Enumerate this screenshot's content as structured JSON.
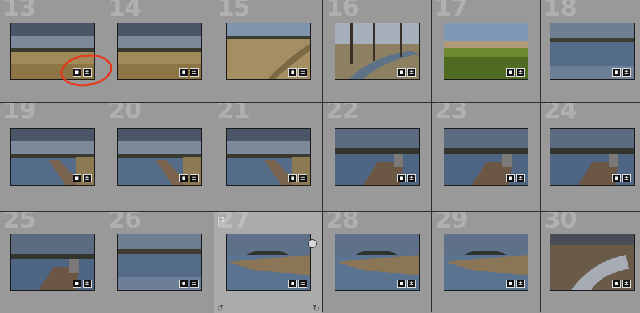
{
  "grid": {
    "cells": [
      {
        "num": "13",
        "scene": "field",
        "selected": false
      },
      {
        "num": "14",
        "scene": "field",
        "selected": false
      },
      {
        "num": "15",
        "scene": "meadow",
        "selected": false
      },
      {
        "num": "16",
        "scene": "creek",
        "selected": false
      },
      {
        "num": "17",
        "scene": "lawn",
        "selected": false
      },
      {
        "num": "18",
        "scene": "lake",
        "selected": false
      },
      {
        "num": "19",
        "scene": "dock",
        "selected": false
      },
      {
        "num": "20",
        "scene": "dock",
        "selected": false
      },
      {
        "num": "21",
        "scene": "dock",
        "selected": false
      },
      {
        "num": "22",
        "scene": "pier",
        "selected": false
      },
      {
        "num": "23",
        "scene": "pier",
        "selected": false
      },
      {
        "num": "24",
        "scene": "pier",
        "selected": false
      },
      {
        "num": "25",
        "scene": "pier",
        "selected": false
      },
      {
        "num": "26",
        "scene": "lake",
        "selected": false
      },
      {
        "num": "27",
        "scene": "shore",
        "selected": true
      },
      {
        "num": "28",
        "scene": "shore",
        "selected": false
      },
      {
        "num": "29",
        "scene": "shore",
        "selected": false
      },
      {
        "num": "30",
        "scene": "marsh",
        "selected": false
      }
    ]
  },
  "badges": {
    "comment_icon": "comment-icon",
    "edit_icon": "develop-adjustment-icon"
  },
  "selected_cell": {
    "flag_icon": "flag-icon",
    "rating_dots": "· · · · ·",
    "rotate_left": "↺",
    "rotate_right": "↻"
  },
  "colors": {
    "annotation": "#e6391c"
  }
}
